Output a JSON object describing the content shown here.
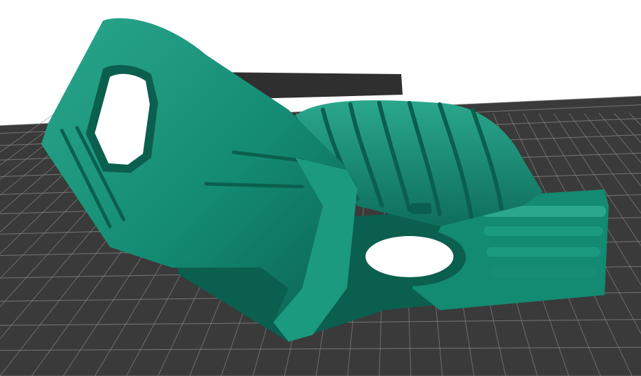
{
  "scene": {
    "background_color": "#ffffff",
    "bed_color": "#3a3a3a",
    "grid_line_color": "#8a8a8a",
    "back_plate_color": "#2f2f2f",
    "model_color": "#138a72",
    "model_shadow_color": "#0b5f4f",
    "model_highlight_color": "#2aa78c",
    "axis_x_color": "#e8572f",
    "model_icon": "3d-model-bracket"
  }
}
